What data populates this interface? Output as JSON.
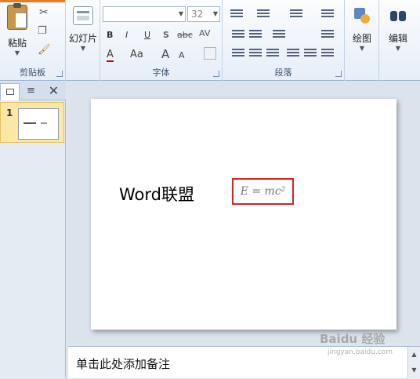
{
  "ribbon": {
    "clipboard": {
      "label": "剪贴板",
      "paste_label": "粘贴"
    },
    "slides": {
      "new_slide_label": "幻灯片"
    },
    "font": {
      "label": "字体",
      "font_name": "",
      "font_size": "32",
      "bold": "B",
      "italic": "I",
      "underline": "U",
      "shadow": "S",
      "strike": "abc",
      "spacing": "AV",
      "font_color": "A",
      "case": "Aa",
      "grow": "A",
      "shrink": "A"
    },
    "paragraph": {
      "label": "段落"
    },
    "drawing": {
      "label": "绘图"
    },
    "editing": {
      "label": "编辑"
    }
  },
  "panel": {
    "slide_number": "1"
  },
  "slide": {
    "title": "Word联盟",
    "equation": "E = mc²"
  },
  "notes": {
    "placeholder": "单击此处添加备注"
  },
  "watermark": {
    "text": "Baidu 经验",
    "url": "jingyan.baidu.com"
  },
  "colors": {
    "accent_orange": "#e47c28",
    "highlight_red": "#d32525",
    "thumb_selected": "#fbe7a6"
  }
}
